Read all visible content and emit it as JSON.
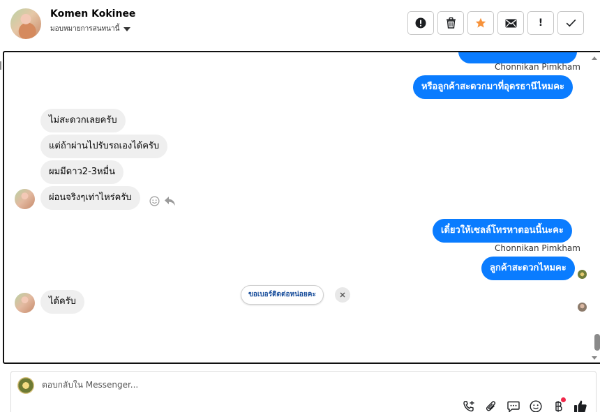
{
  "header": {
    "contact_name": "Komen Kokinee",
    "assign_label": "มอบหมายการสนทนานี้",
    "toolbar": [
      {
        "icon": "alert-circle-icon",
        "label": ""
      },
      {
        "icon": "trash-icon",
        "label": ""
      },
      {
        "icon": "star-icon",
        "label": ""
      },
      {
        "icon": "mail-icon",
        "label": ""
      },
      {
        "icon": "exclamation-icon",
        "label": "!"
      },
      {
        "icon": "check-icon",
        "label": ""
      }
    ],
    "star_color": "#f7923a"
  },
  "messages": [
    {
      "side": "out",
      "text": "หรือลูกค้าสะดวกมาที่อุดรธานีไหมคะ",
      "sender": "Chonnikan Pimkham"
    },
    {
      "side": "in",
      "text": "ไม่สะดวกเลยครับ"
    },
    {
      "side": "in",
      "text": "แต่ถ้าผ่านไปรับรถเองได้ครับ"
    },
    {
      "side": "in",
      "text": "ผมมีดาว2-3หมื่น"
    },
    {
      "side": "in",
      "text": "ผ่อนจริงๆเท่าไหร่ครับ"
    },
    {
      "side": "out",
      "text": "เดี๋ยวให้เซลล์โทรหาตอนนี้นะคะ"
    },
    {
      "side": "out",
      "text": "ลูกค้าสะดวกไหมคะ",
      "sender": "Chonnikan Pimkham"
    },
    {
      "side": "in",
      "text": "ได้ครับ"
    }
  ],
  "quick_reply": {
    "label": "ขอเบอร์ติดต่อหน่อยคะ"
  },
  "reply_box": {
    "placeholder": "ตอบกลับใน Messenger...",
    "tools": [
      "phone-add-icon",
      "paperclip-icon",
      "saved-reply-icon",
      "emoji-icon",
      "baht-icon",
      "like-icon"
    ]
  },
  "colors": {
    "outgoing_bubble": "#0a7cff",
    "incoming_bubble": "#efefef",
    "notification_dot": "#f0284a"
  }
}
